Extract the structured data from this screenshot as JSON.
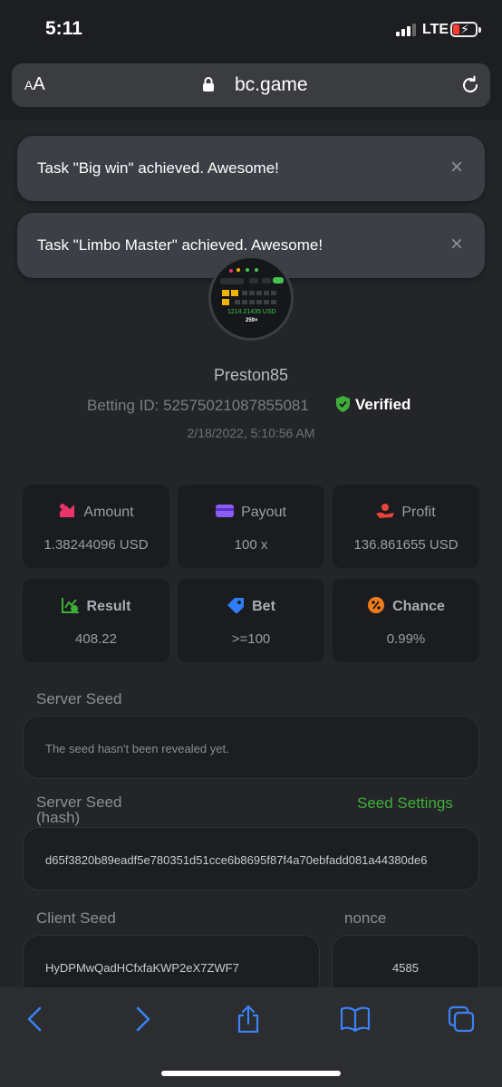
{
  "status_bar": {
    "time": "5:11",
    "network": "LTE"
  },
  "url_bar": {
    "text_size_label": "AA",
    "domain": "bc.game"
  },
  "toasts": [
    {
      "message": "Task \"Big win\" achieved. Awesome!",
      "close": "×"
    },
    {
      "message": "Task \"Limbo Master\" achieved. Awesome!",
      "close": "×"
    }
  ],
  "avatar": {
    "amount": "1214.21435 USD",
    "multiplier": "259×"
  },
  "profile": {
    "username": "Preston85",
    "betting_id": "Betting ID: 52575021087855081",
    "verified": "Verified",
    "date": "2/18/2022, 5:10:56 AM"
  },
  "stats": [
    {
      "label": "Amount",
      "value": "1.38244096 USD",
      "icon": "coins-icon",
      "color": "#e8336b"
    },
    {
      "label": "Payout",
      "value": "100 x",
      "icon": "wallet-icon",
      "color": "#8b5cf6"
    },
    {
      "label": "Profit",
      "value": "136.861655 USD",
      "icon": "hand-coin-icon",
      "color": "#e8443a"
    },
    {
      "label": "Result",
      "value": "408.22",
      "icon": "chart-check-icon",
      "color": "#3fae38"
    },
    {
      "label": "Bet",
      "value": ">=100",
      "icon": "tag-icon",
      "color": "#2f7cf6"
    },
    {
      "label": "Chance",
      "value": "0.99%",
      "icon": "percent-icon",
      "color": "#f07b1a"
    }
  ],
  "server_seed": {
    "label": "Server Seed",
    "value": "The seed hasn't been revealed yet."
  },
  "server_seed_hash": {
    "label_line1": "Server Seed",
    "label_line2": "(hash)",
    "settings_link": "Seed Settings",
    "value": "d65f3820b89eadf5e780351d51cce6b8695f87f4a70ebfadd081a44380de6"
  },
  "client_seed": {
    "label": "Client Seed",
    "value": "HyDPMwQadHCfxfaKWP2eX7ZWF7"
  },
  "nonce": {
    "label": "nonce",
    "value": "4585"
  }
}
